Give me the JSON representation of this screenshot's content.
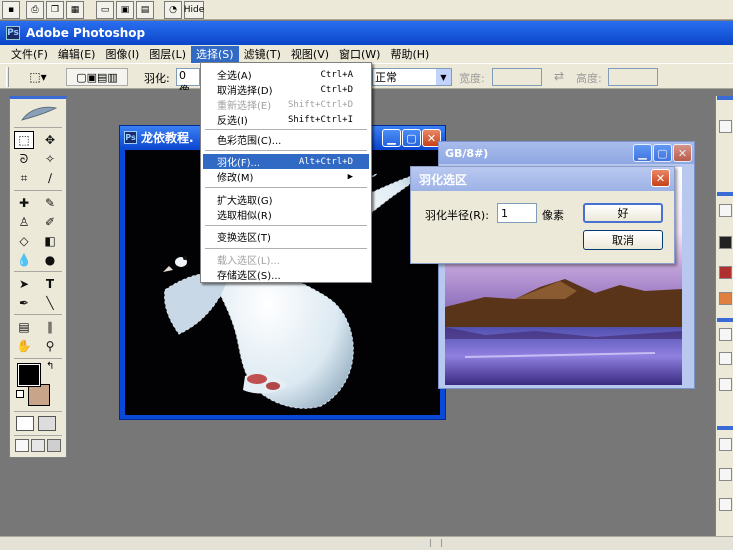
{
  "app": {
    "title": "Adobe Photoshop"
  },
  "top_strip": {
    "hide_label": "Hide"
  },
  "menu": [
    {
      "label": "文件(F)"
    },
    {
      "label": "编辑(E)"
    },
    {
      "label": "图像(I)"
    },
    {
      "label": "图层(L)"
    },
    {
      "label": "选择(S)",
      "active": true
    },
    {
      "label": "滤镜(T)"
    },
    {
      "label": "视图(V)"
    },
    {
      "label": "窗口(W)"
    },
    {
      "label": "帮助(H)"
    }
  ],
  "options": {
    "feather_label": "羽化:",
    "feather_value": "0 像",
    "style_value": "正常",
    "width_label": "宽度:",
    "height_label": "高度:"
  },
  "select_menu": {
    "items": [
      {
        "label": "全选(A)",
        "shortcut": "Ctrl+A",
        "disabled": false,
        "highlighted": false
      },
      {
        "label": "取消选择(D)",
        "shortcut": "Ctrl+D",
        "disabled": false,
        "highlighted": false
      },
      {
        "label": "重新选择(E)",
        "shortcut": "Shift+Ctrl+D",
        "disabled": true,
        "highlighted": false
      },
      {
        "label": "反选(I)",
        "shortcut": "Shift+Ctrl+I",
        "disabled": false,
        "highlighted": false
      },
      {
        "label": "色彩范围(C)...",
        "shortcut": "",
        "disabled": false,
        "highlighted": false
      },
      {
        "label": "羽化(F)...",
        "shortcut": "Alt+Ctrl+D",
        "disabled": false,
        "highlighted": true
      },
      {
        "label": "修改(M)",
        "shortcut": "▶",
        "disabled": false,
        "highlighted": false
      },
      {
        "label": "扩大选取(G)",
        "shortcut": "",
        "disabled": false,
        "highlighted": false
      },
      {
        "label": "选取相似(R)",
        "shortcut": "",
        "disabled": false,
        "highlighted": false
      },
      {
        "label": "变换选区(T)",
        "shortcut": "",
        "disabled": false,
        "highlighted": false
      },
      {
        "label": "载入选区(L)...",
        "shortcut": "",
        "disabled": true,
        "highlighted": false
      },
      {
        "label": "存储选区(S)...",
        "shortcut": "",
        "disabled": false,
        "highlighted": false
      }
    ]
  },
  "doc1": {
    "title": "龙依教程."
  },
  "doc2": {
    "title": "GB/8#)"
  },
  "feather_dialog": {
    "title": "羽化选区",
    "radius_label": "羽化半径(R):",
    "radius_value": "1",
    "unit": "像素",
    "ok_label": "好",
    "cancel_label": "取消"
  },
  "colors": {
    "xp_blue": "#0a45c8",
    "menu_highlight": "#316ac5",
    "workspace": "#777777",
    "foreground_color": "#000000",
    "background_color": "#c8a48a"
  }
}
